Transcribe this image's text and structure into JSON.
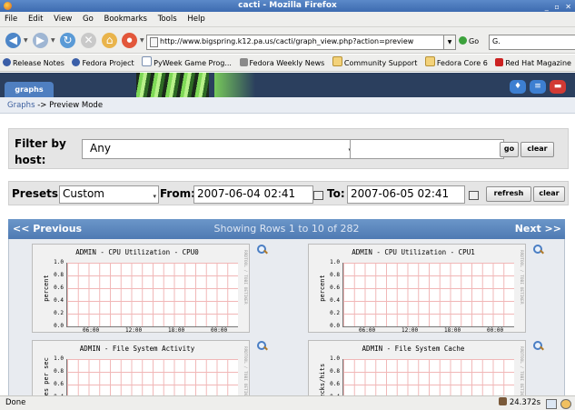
{
  "window": {
    "title": "cacti - Mozilla Firefox"
  },
  "menu": [
    "File",
    "Edit",
    "View",
    "Go",
    "Bookmarks",
    "Tools",
    "Help"
  ],
  "nav": {
    "url": "http://www.bigspring.k12.pa.us/cacti/graph_view.php?action=preview",
    "go_label": "Go",
    "search_placeholder": "G."
  },
  "bookmarks": [
    "Release Notes",
    "Fedora Project",
    "PyWeek Game Prog...",
    "Fedora Weekly News",
    "Community Support",
    "Fedora Core 6",
    "Red Hat Magazine"
  ],
  "header": {
    "tab_label": "graphs"
  },
  "breadcrumb": {
    "link": "Graphs",
    "separator": " -> ",
    "current": "Preview Mode"
  },
  "filter": {
    "label": "Filter by host:",
    "host_value": "Any",
    "text_value": "",
    "go_label": "go",
    "clear_label": "clear"
  },
  "presets": {
    "label": "Presets:",
    "value": "Custom",
    "from_label": "From:",
    "from_value": "2007-06-04 02:41",
    "to_label": "To:",
    "to_value": "2007-06-05 02:41",
    "refresh_label": "refresh",
    "clear_label": "clear"
  },
  "pager": {
    "prev": "<< Previous",
    "info": "Showing Rows 1 to 10 of 282",
    "next": "Next >>"
  },
  "graphs": [
    {
      "title": "ADMIN - CPU Utilization - CPU0",
      "ylabel": "percent",
      "yticks": [
        "1.0",
        "0.8",
        "0.6",
        "0.4",
        "0.2",
        "0.0"
      ],
      "xticks": [
        "06:00",
        "12:00",
        "18:00",
        "00:00"
      ],
      "side_text": "RRDTOOL / TOBI OETIKER"
    },
    {
      "title": "ADMIN - CPU Utilization - CPU1",
      "ylabel": "percent",
      "yticks": [
        "1.0",
        "0.8",
        "0.6",
        "0.4",
        "0.2",
        "0.0"
      ],
      "xticks": [
        "06:00",
        "12:00",
        "18:00",
        "00:00"
      ],
      "side_text": "RRDTOOL / TOBI OETIKER"
    },
    {
      "title": "ADMIN - File System Activity",
      "ylabel": "rites per sec",
      "yticks": [
        "1.0",
        "0.8",
        "0.6",
        "0.4"
      ],
      "xticks": [],
      "side_text": "RRDTOOL / TOBI OETIKER"
    },
    {
      "title": "ADMIN - File System Cache",
      "ylabel": "checks/hits",
      "yticks": [
        "1.0",
        "0.8",
        "0.6",
        "0.4"
      ],
      "xticks": [],
      "side_text": "RRDTOOL / TOBI OETIKER"
    }
  ],
  "status": {
    "text": "Done",
    "time": "24.372s"
  },
  "colors": {
    "titlebar": "#4a78bd",
    "cacti_header": "#2b3f5e",
    "pager_bar": "#5f8bc2",
    "grid": "#f1b7b7"
  }
}
